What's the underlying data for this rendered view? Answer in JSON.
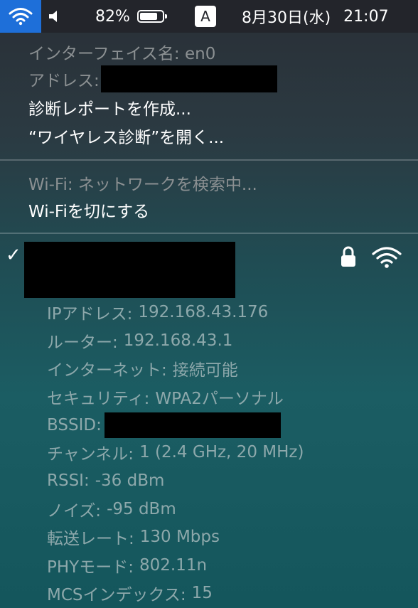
{
  "menubar": {
    "volume_icon": "speaker-icon",
    "battery_percent": "82%",
    "battery_level": 0.82,
    "input_source": "A",
    "date": "8月30日(水)",
    "time": "21:07"
  },
  "interface_section": {
    "interface_name": "インターフェイス名: en0",
    "address_label": "アドレス:",
    "create_report": "診断レポートを作成...",
    "open_wireless_diagnostics": "“ワイヤレス診断”を開く..."
  },
  "wifi_section": {
    "status": "Wi-Fi: ネットワークを検索中...",
    "turn_off": "Wi-Fiを切にする"
  },
  "network": {
    "connected_mark": "✓",
    "details": [
      {
        "label": "IPアドレス:",
        "value": "192.168.43.176"
      },
      {
        "label": "ルーター:",
        "value": "192.168.43.1"
      },
      {
        "label": "インターネット:",
        "value": "接続可能"
      },
      {
        "label": "セキュリティ:",
        "value": "WPA2パーソナル"
      },
      {
        "label": "BSSID:",
        "value": ""
      },
      {
        "label": "チャンネル:",
        "value": "1 (2.4 GHz, 20 MHz)"
      },
      {
        "label": "RSSI:",
        "value": "-36 dBm"
      },
      {
        "label": "ノイズ:",
        "value": "-95 dBm"
      },
      {
        "label": "転送レート:",
        "value": "130 Mbps"
      },
      {
        "label": "PHYモード:",
        "value": "802.11n"
      },
      {
        "label": "MCSインデックス:",
        "value": "15"
      }
    ]
  },
  "colors": {
    "accent": "#1e6fd9",
    "menubar": "#23252b",
    "dim_text": "#8b9092",
    "detail_text": "#8da8ab"
  }
}
